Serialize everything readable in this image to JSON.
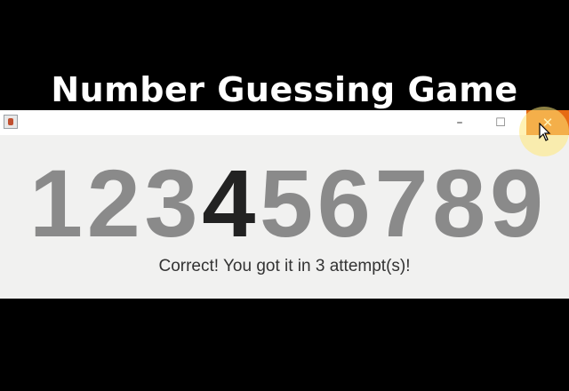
{
  "page": {
    "title": "Number Guessing Game"
  },
  "window": {
    "controls": {
      "minimize": "–",
      "maximize": "☐",
      "close": "✕"
    }
  },
  "game": {
    "digits": [
      "1",
      "2",
      "3",
      "4",
      "5",
      "6",
      "7",
      "8",
      "9"
    ],
    "selected_digit": "4",
    "status_message": "Correct! You got it in 3 attempt(s)!"
  },
  "colors": {
    "background": "#000000",
    "window": "#f1f1f0",
    "digit": "#8a8a8a",
    "digit_selected": "#222222",
    "close_button": "#e66a12"
  },
  "icons": [
    "java-app-icon",
    "minimize-icon",
    "maximize-icon",
    "close-icon",
    "mouse-cursor-icon"
  ]
}
